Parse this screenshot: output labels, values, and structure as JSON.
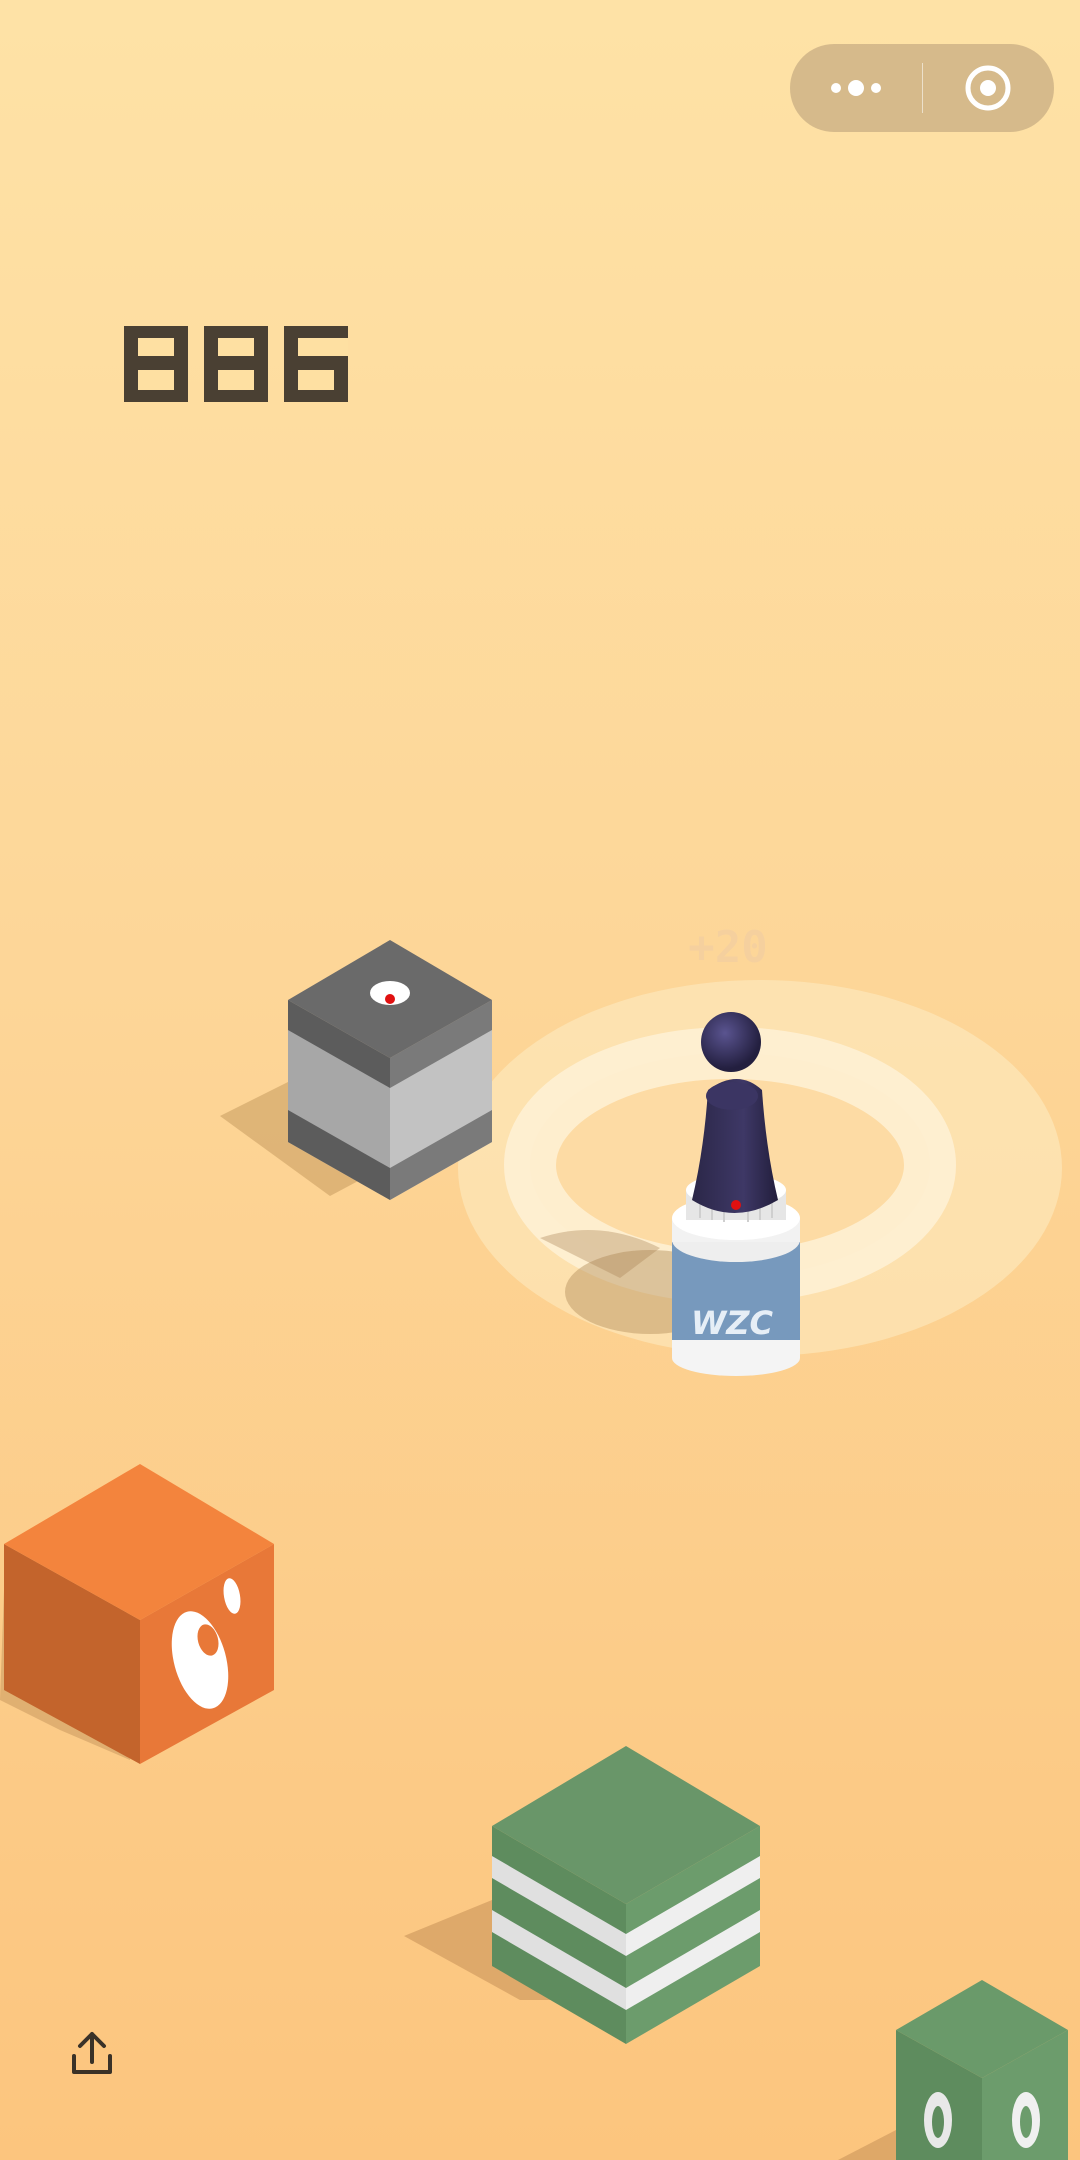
{
  "game": {
    "score": "886",
    "bonus_popup": "+20",
    "bottle_label": "WZC"
  },
  "top_capsule": {
    "more_icon": "more-dots-icon",
    "close_icon": "target-close-icon"
  },
  "bottom_bar": {
    "share_icon": "share-upload-icon"
  },
  "colors": {
    "background_top": "#fee2a6",
    "background_bottom": "#fcc57e",
    "score_digits": "#4a4033",
    "gray_cube": "#8a8a8a",
    "orange_cube": "#f08035",
    "green_cube": "#6a9a6a",
    "bottle_blue": "#6f93b8",
    "piece": "#2e2a4f"
  }
}
